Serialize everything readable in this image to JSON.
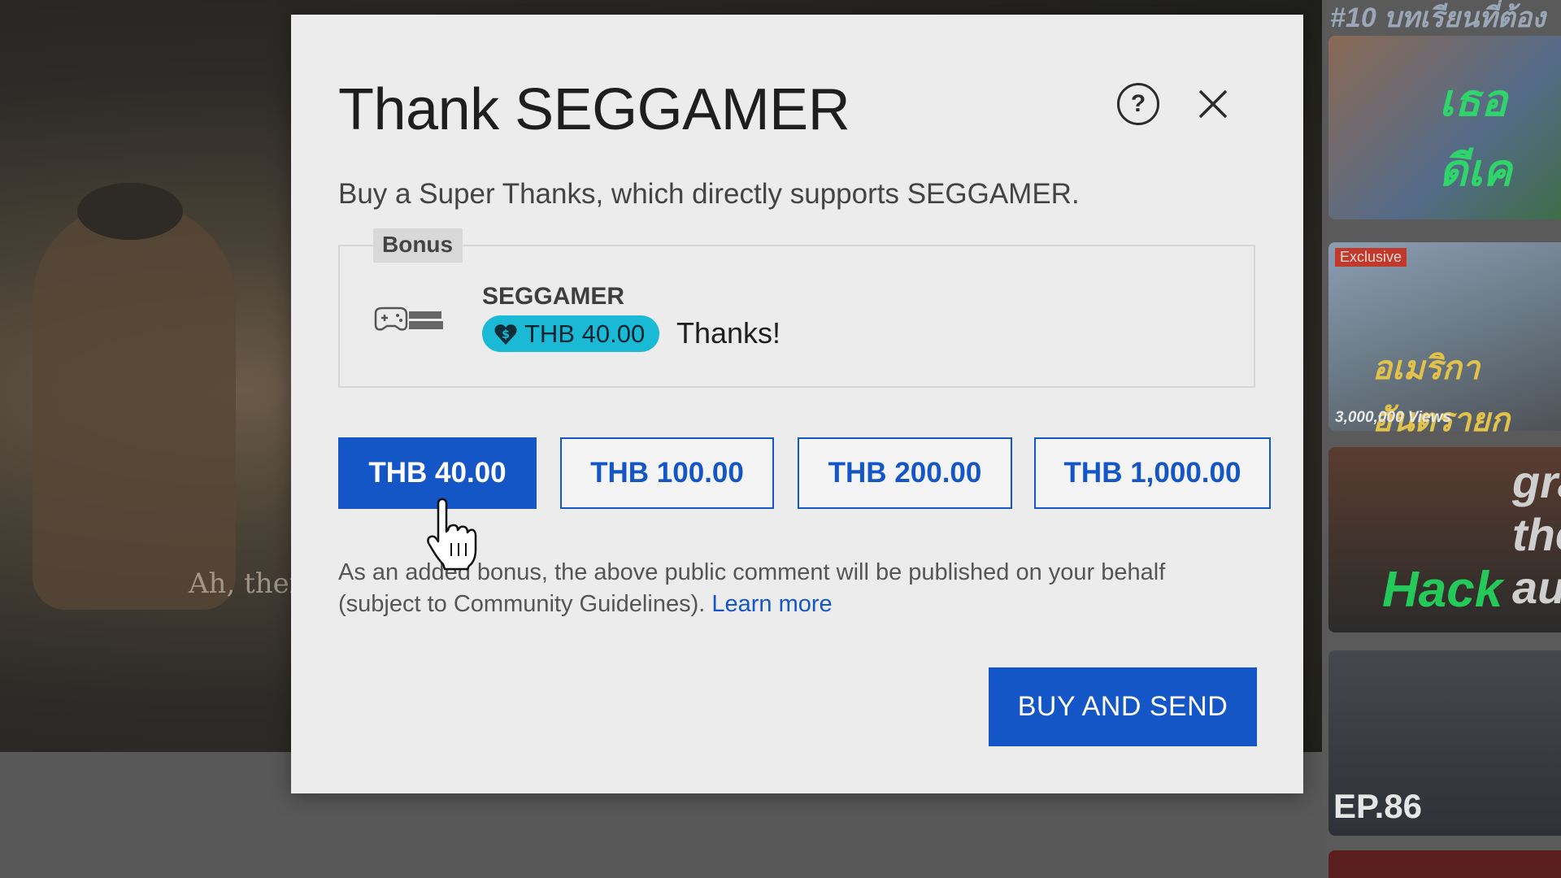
{
  "background": {
    "video_subtitle": "Ah, ther",
    "sidebar_top_text": "#10 บทเรียนที่ต้อง",
    "thumbnails": [
      {
        "text": "เธอดีเค"
      },
      {
        "badge": "Exclusive",
        "text": "อเมริกา อันตรายก",
        "views": "3,000,000 Views"
      },
      {
        "text": "Hack",
        "text2": "gra the aut"
      },
      {
        "text": "EP.86"
      }
    ]
  },
  "modal": {
    "title": "Thank SEGGAMER",
    "subtitle": "Buy a Super Thanks, which directly supports SEGGAMER.",
    "help_icon": "question-circle-icon",
    "close_icon": "close-icon",
    "preview": {
      "tag": "Bonus",
      "avatar_icon": "gamepad-logo",
      "author": "SEGGAMER",
      "amount": "THB 40.00",
      "amount_icon": "heart-dollar-icon",
      "comment": "Thanks!",
      "chip_color": "#1ab9d6"
    },
    "amounts": [
      "THB 40.00",
      "THB 100.00",
      "THB 200.00",
      "THB 1,000.00"
    ],
    "selected_amount": "THB 40.00",
    "disclaimer": "As an added bonus, the above public comment will be published on your behalf (subject to Community Guidelines).",
    "learn_more": "Learn more",
    "buy_button": "BUY AND SEND",
    "accent_color": "#1556c6"
  }
}
